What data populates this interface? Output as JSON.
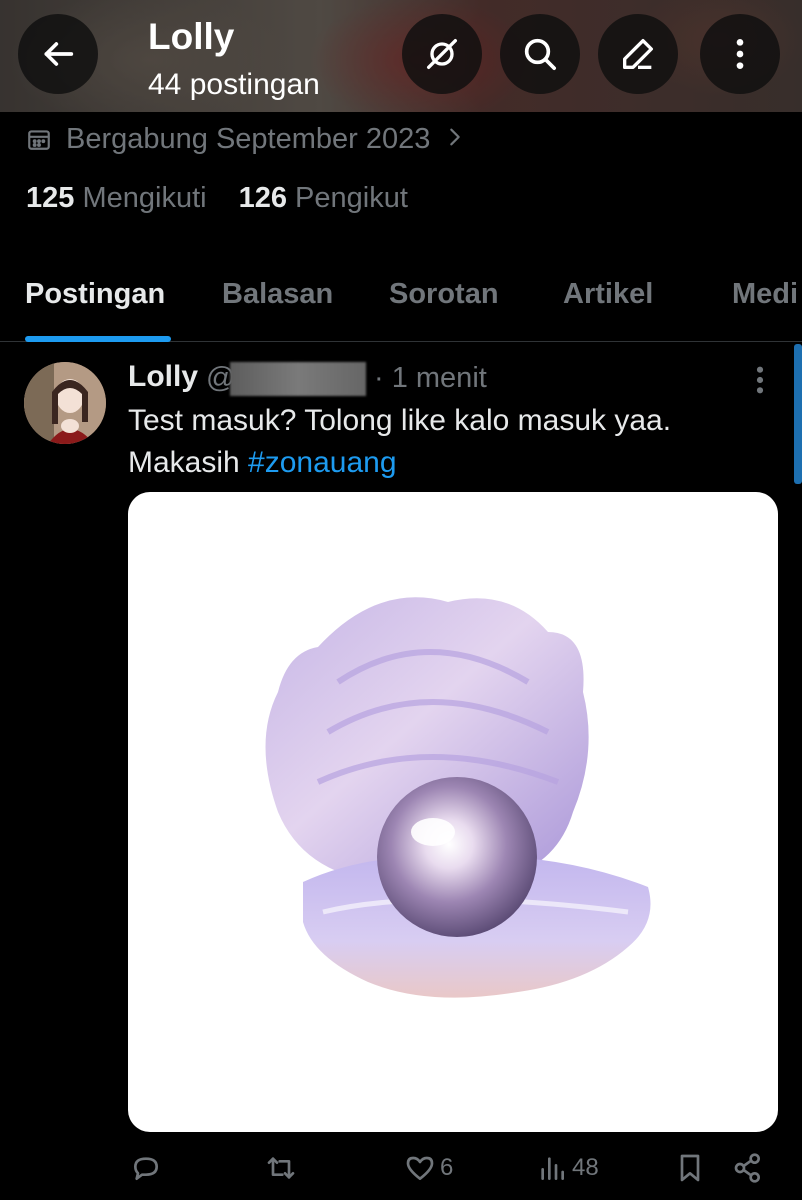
{
  "header": {
    "title": "Lolly",
    "subtitle": "44 postingan",
    "icons": [
      "arrow-left-icon",
      "spaces-off-icon",
      "search-icon",
      "edit-icon",
      "more-vertical-icon"
    ]
  },
  "profile": {
    "joined": "Bergabung September 2023",
    "following_count": "125",
    "following_label": "Mengikuti",
    "followers_count": "126",
    "followers_label": "Pengikut"
  },
  "tabs": [
    {
      "label": "Postingan",
      "active": true
    },
    {
      "label": "Balasan",
      "active": false
    },
    {
      "label": "Sorotan",
      "active": false
    },
    {
      "label": "Artikel",
      "active": false
    },
    {
      "label": "Medi",
      "active": false
    }
  ],
  "tweet": {
    "name": "Lolly",
    "handle_prefix": "@",
    "time": "· 1 menit",
    "text_before": "Test masuk? Tolong like kalo masuk yaa. Makasih ",
    "hashtag": "#zonauang",
    "likes": "6",
    "views": "48"
  },
  "colors": {
    "accent": "#1d9bf0",
    "muted": "#71767b",
    "text": "#e7e9ea",
    "background": "#000000"
  }
}
